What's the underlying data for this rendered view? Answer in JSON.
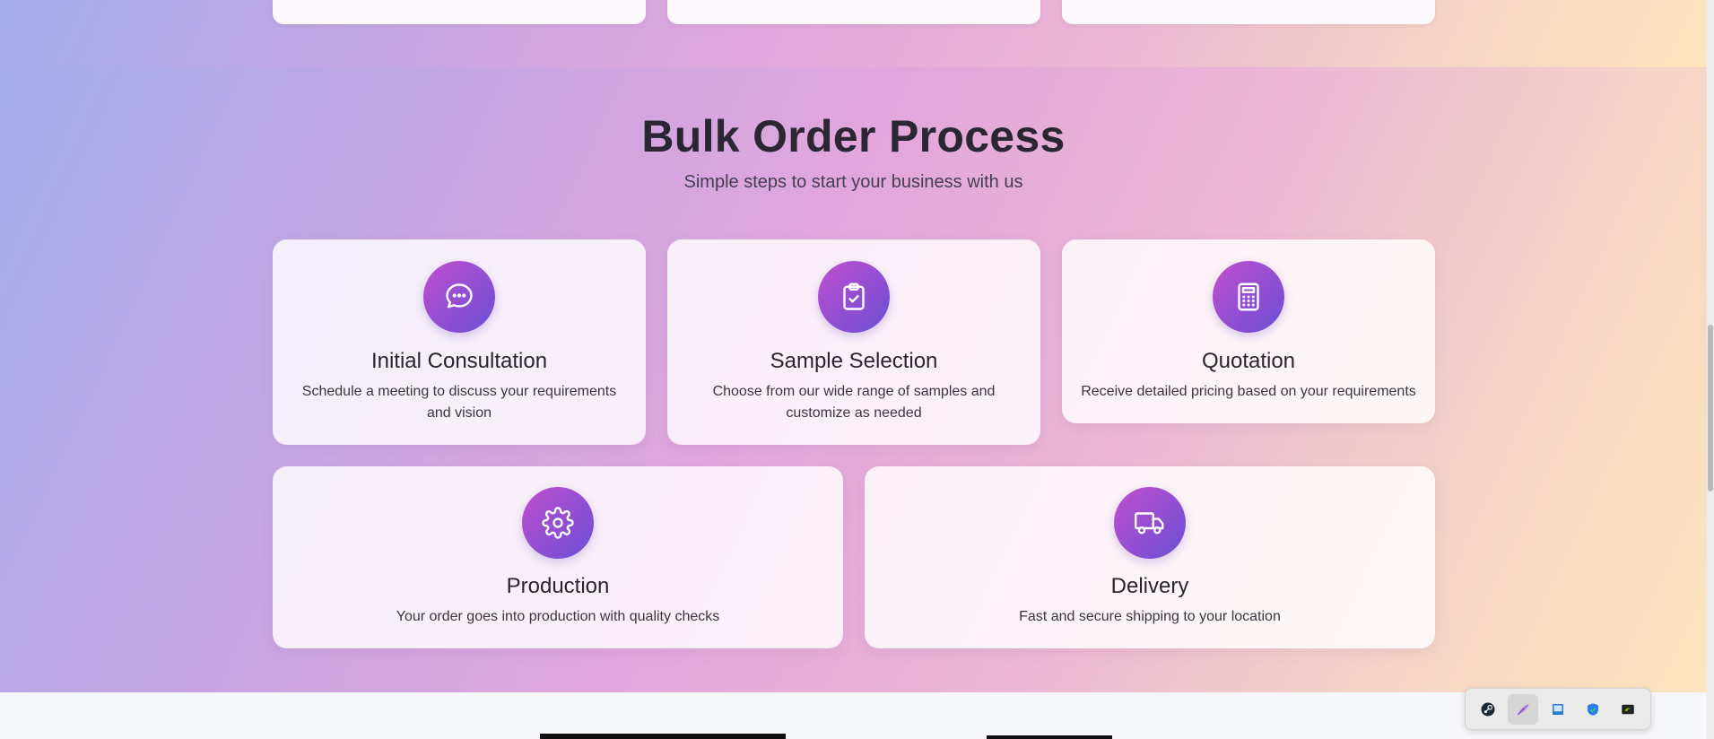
{
  "section": {
    "title": "Bulk Order Process",
    "subtitle": "Simple steps to start your business with us"
  },
  "steps": [
    {
      "icon": "chat-bubble-icon",
      "title": "Initial Consultation",
      "description": "Schedule a meeting to discuss your requirements and vision"
    },
    {
      "icon": "clipboard-check-icon",
      "title": "Sample Selection",
      "description": "Choose from our wide range of samples and customize as needed"
    },
    {
      "icon": "calculator-icon",
      "title": "Quotation",
      "description": "Receive detailed pricing based on your requirements"
    },
    {
      "icon": "gear-icon",
      "title": "Production",
      "description": "Your order goes into production with quality checks"
    },
    {
      "icon": "truck-icon",
      "title": "Delivery",
      "description": "Fast and secure shipping to your location"
    }
  ],
  "tray": {
    "items": [
      {
        "icon": "steam-icon",
        "active": false
      },
      {
        "icon": "feather-icon",
        "active": true
      },
      {
        "icon": "window-icon",
        "active": false
      },
      {
        "icon": "shield-check-icon",
        "active": false
      },
      {
        "icon": "nvidia-icon",
        "active": false
      }
    ]
  },
  "colors": {
    "icon_gradient_start": "#c04fce",
    "icon_gradient_end": "#6a4fd6",
    "title_color": "#2b2633"
  }
}
